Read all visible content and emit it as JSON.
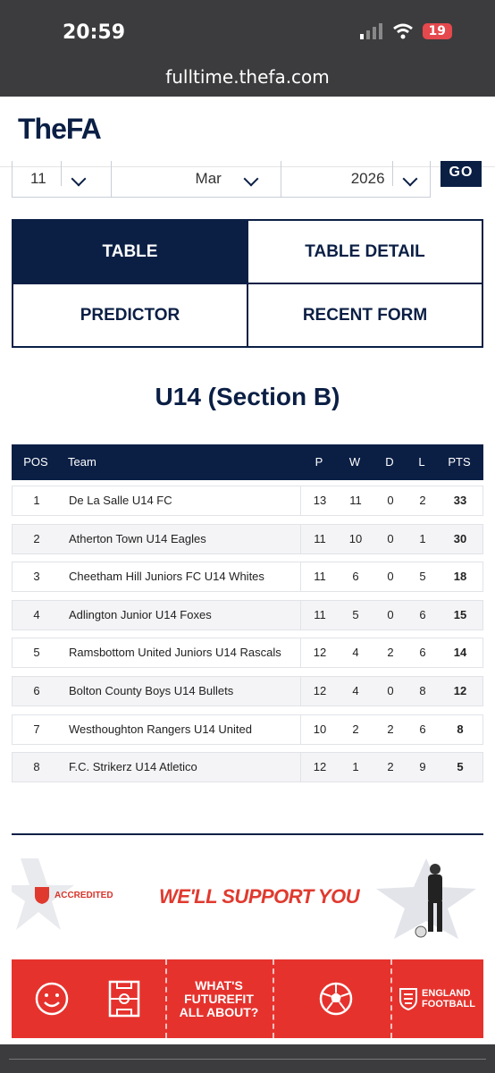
{
  "status": {
    "time": "20:59",
    "battery": "19"
  },
  "url": "fulltime.thefa.com",
  "brand": {
    "logo": "TheFA"
  },
  "date_picker": {
    "day": "11",
    "month": "Mar",
    "year": "2026",
    "go_label": "GO"
  },
  "tabs": [
    {
      "label": "TABLE",
      "active": true
    },
    {
      "label": "TABLE DETAIL",
      "active": false
    },
    {
      "label": "PREDICTOR",
      "active": false
    },
    {
      "label": "RECENT FORM",
      "active": false
    }
  ],
  "section_title": "U14 (Section B)",
  "table": {
    "headers": {
      "pos": "POS",
      "team": "Team",
      "p": "P",
      "w": "W",
      "d": "D",
      "l": "L",
      "pts": "PTS"
    },
    "rows": [
      {
        "pos": "1",
        "team": "De La Salle U14 FC",
        "p": "13",
        "w": "11",
        "d": "0",
        "l": "2",
        "pts": "33"
      },
      {
        "pos": "2",
        "team": "Atherton Town U14 Eagles",
        "p": "11",
        "w": "10",
        "d": "0",
        "l": "1",
        "pts": "30"
      },
      {
        "pos": "3",
        "team": "Cheetham Hill Juniors FC U14 Whites",
        "p": "11",
        "w": "6",
        "d": "0",
        "l": "5",
        "pts": "18"
      },
      {
        "pos": "4",
        "team": "Adlington Junior U14 Foxes",
        "p": "11",
        "w": "5",
        "d": "0",
        "l": "6",
        "pts": "15"
      },
      {
        "pos": "5",
        "team": "Ramsbottom United Juniors U14 Rascals",
        "p": "12",
        "w": "4",
        "d": "2",
        "l": "6",
        "pts": "14"
      },
      {
        "pos": "6",
        "team": "Bolton County Boys U14 Bullets",
        "p": "12",
        "w": "4",
        "d": "0",
        "l": "8",
        "pts": "12"
      },
      {
        "pos": "7",
        "team": "Westhoughton Rangers U14 United",
        "p": "10",
        "w": "2",
        "d": "2",
        "l": "6",
        "pts": "8"
      },
      {
        "pos": "8",
        "team": "F.C. Strikerz U14 Atletico",
        "p": "12",
        "w": "1",
        "d": "2",
        "l": "9",
        "pts": "5"
      }
    ]
  },
  "banner_support": {
    "accredited": "ACCREDITED",
    "slogan": "WE'LL SUPPORT YOU"
  },
  "banner_futurefit": {
    "line1": "WHAT'S",
    "line2": "FUTUREFIT",
    "line3": "ALL ABOUT?",
    "eng_line1": "ENGLAND",
    "eng_line2": "FOOTBALL"
  },
  "colors": {
    "navy": "#0b1f45",
    "red": "#e6322d"
  }
}
